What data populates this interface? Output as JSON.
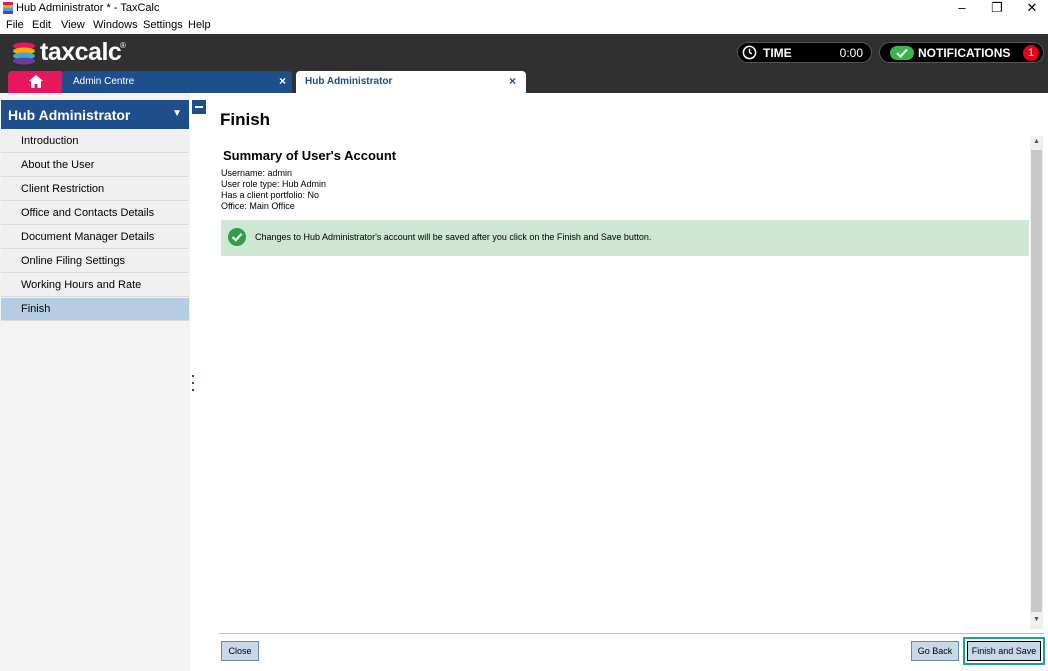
{
  "window": {
    "title": "Hub Administrator * - TaxCalc",
    "minimize": "–",
    "maximize": "❐",
    "close": "✕"
  },
  "menu": [
    "File",
    "Edit",
    "View",
    "Windows",
    "Settings",
    "Help"
  ],
  "header": {
    "logo_text": "taxcalc",
    "logo_mark": "®",
    "time_label": "TIME",
    "time_value": "0:00",
    "notifications_label": "NOTIFICATIONS",
    "notifications_count": "1"
  },
  "tabs": [
    {
      "label": "",
      "icon": "home-icon"
    },
    {
      "label": "Admin Centre",
      "close": "×"
    },
    {
      "label": "Hub Administrator",
      "close": "×"
    }
  ],
  "sidebar": {
    "title": "Hub Administrator",
    "arrow": "▼",
    "items": [
      {
        "label": "Introduction",
        "active": false
      },
      {
        "label": "About the User",
        "active": false
      },
      {
        "label": "Client Restriction",
        "active": false
      },
      {
        "label": "Office and Contacts Details",
        "active": false
      },
      {
        "label": "Document Manager Details",
        "active": false
      },
      {
        "label": "Online Filing Settings",
        "active": false
      },
      {
        "label": "Working Hours and Rate",
        "active": false
      },
      {
        "label": "Finish",
        "active": true
      }
    ]
  },
  "main": {
    "title": "Finish",
    "summary_title": "Summary of User's Account",
    "info": [
      "Username: admin",
      "User role type: Hub Admin",
      "Has a client portfolio: No",
      "Office: Main Office"
    ],
    "notice": "Changes to Hub Administrator's account will be saved after you click on the Finish and Save button."
  },
  "buttons": {
    "close": "Close",
    "back": "Go Back",
    "finish": "Finish and Save"
  },
  "colors": {
    "header_bg": "#303030",
    "brand_blue": "#1f4e8c",
    "home_tab": "#e8175d",
    "notice_bg": "#cde7d4",
    "focus_ring": "#17a398"
  }
}
